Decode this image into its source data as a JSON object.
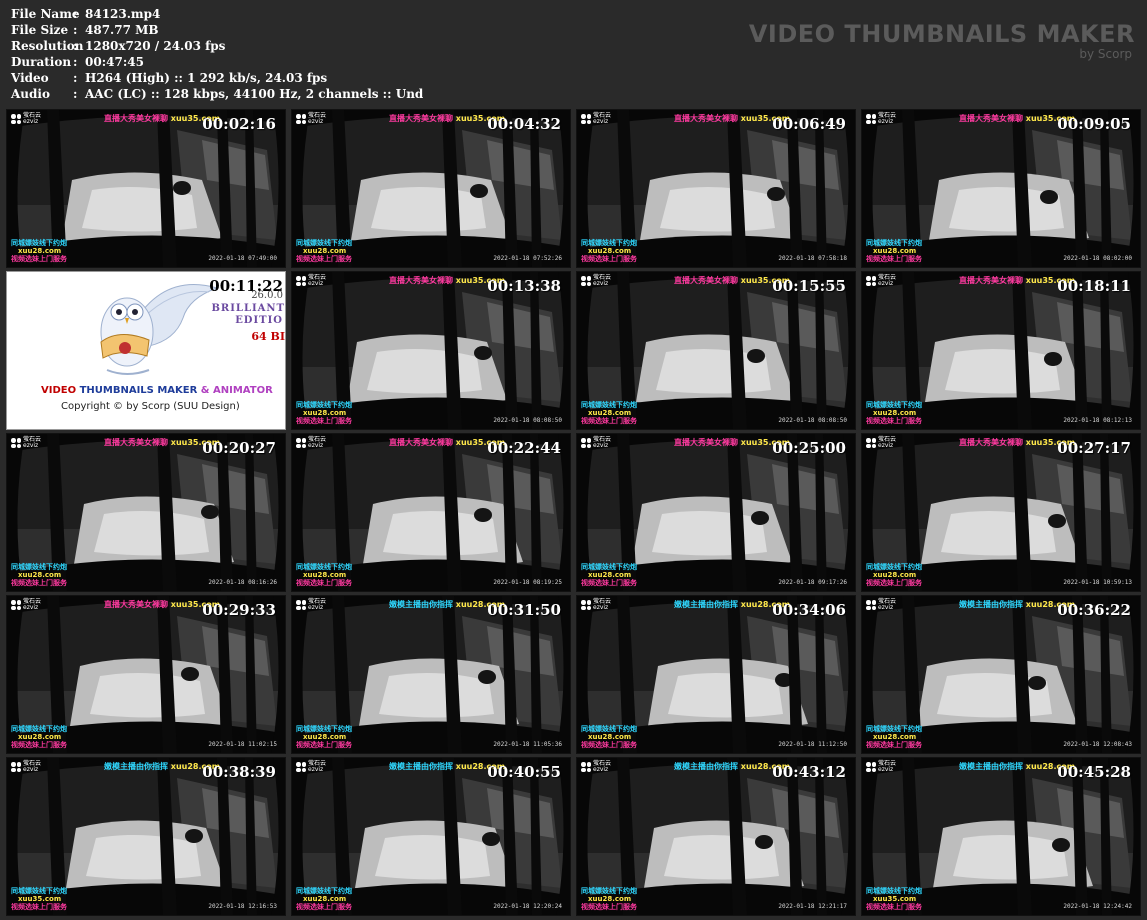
{
  "info": [
    {
      "label": "File Name",
      "value": "84123.mp4"
    },
    {
      "label": "File Size",
      "value": "487.77 MB"
    },
    {
      "label": "Resolution",
      "value": "1280x720 / 24.03 fps"
    },
    {
      "label": "Duration",
      "value": "00:47:45"
    },
    {
      "label": "Video",
      "value": "H264 (High) :: 1 292 kb/s, 24.03 fps"
    },
    {
      "label": "Audio",
      "value": "AAC (LC) :: 128 kbps, 44100 Hz, 2 channels :: Und"
    }
  ],
  "separator": ":",
  "brand": {
    "title": "VIDEO THUMBNAILS MAKER",
    "sub": "by Scorp"
  },
  "camera_logo": {
    "cn": "萤石云",
    "en": "ezviz"
  },
  "overlay_bottom": {
    "l1": "同城嫖妓线下约炮",
    "l2": "xuu28.com",
    "l3": "视频选妹上门服务"
  },
  "overlay_bottom_alt": {
    "l1": "同城嫖妓线下约炮",
    "l2": "xuu35.com",
    "l3": "视频选妹上门服务"
  },
  "overlay_top": {
    "cn": "直播大秀美女裸聊",
    "url": "xuu35.com"
  },
  "overlay_top_alt": {
    "cn": "嫩模主播由你指挥",
    "url": "xuu28.com"
  },
  "promo": {
    "timestamp": "00:11:22",
    "version": "26.0.0",
    "ed1": "BRILLIANT",
    "ed2": "EDITIO",
    "ed3": "64 BI",
    "title_a": "VIDEO ",
    "title_b": "THUMBNAILS MAKER",
    "title_c": " & ANIMATOR",
    "copyright": "Copyright © by Scorp (SUU Design)"
  },
  "thumbnails": [
    {
      "time": "00:02:16",
      "date": "2022-01-18 07:49:00",
      "top": "a",
      "bottom": "a"
    },
    {
      "time": "00:04:32",
      "date": "2022-01-18 07:52:26",
      "top": "a",
      "bottom": "a"
    },
    {
      "time": "00:06:49",
      "date": "2022-01-18 07:58:18",
      "top": "a",
      "bottom": "a"
    },
    {
      "time": "00:09:05",
      "date": "2022-01-18 08:02:00",
      "top": "a",
      "bottom": "a"
    },
    {
      "time": "promo"
    },
    {
      "time": "00:13:38",
      "date": "2022-01-18 08:08:50",
      "top": "a",
      "bottom": "a"
    },
    {
      "time": "00:15:55",
      "date": "2022-01-18 08:08:50",
      "top": "a",
      "bottom": "a"
    },
    {
      "time": "00:18:11",
      "date": "2022-01-18 08:12:13",
      "top": "a",
      "bottom": "a"
    },
    {
      "time": "00:20:27",
      "date": "2022-01-18 08:16:26",
      "top": "a",
      "bottom": "a"
    },
    {
      "time": "00:22:44",
      "date": "2022-01-18 08:19:25",
      "top": "a",
      "bottom": "a"
    },
    {
      "time": "00:25:00",
      "date": "2022-01-18 09:17:26",
      "top": "a",
      "bottom": "a"
    },
    {
      "time": "00:27:17",
      "date": "2022-01-18 10:59:13",
      "top": "a",
      "bottom": "a"
    },
    {
      "time": "00:29:33",
      "date": "2022-01-18 11:02:15",
      "top": "a",
      "bottom": "a"
    },
    {
      "time": "00:31:50",
      "date": "2022-01-18 11:05:36",
      "top": "b",
      "bottom": "a"
    },
    {
      "time": "00:34:06",
      "date": "2022-01-18 11:12:50",
      "top": "b",
      "bottom": "a"
    },
    {
      "time": "00:36:22",
      "date": "2022-01-18 12:08:43",
      "top": "b",
      "bottom": "a"
    },
    {
      "time": "00:38:39",
      "date": "2022-01-18 12:16:53",
      "top": "b",
      "bottom": "b"
    },
    {
      "time": "00:40:55",
      "date": "2022-01-18 12:20:24",
      "top": "b",
      "bottom": "a"
    },
    {
      "time": "00:43:12",
      "date": "2022-01-18 12:21:17",
      "top": "b",
      "bottom": "a"
    },
    {
      "time": "00:45:28",
      "date": "2022-01-18 12:24:42",
      "top": "b",
      "bottom": "b"
    }
  ]
}
